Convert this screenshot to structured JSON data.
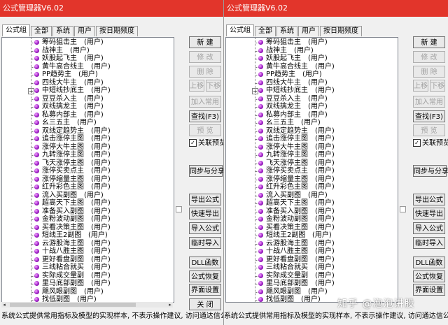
{
  "window_title": "公式管理器V6.02",
  "tabs": [
    "公式组",
    "全部",
    "系统",
    "用户",
    "按日期频度"
  ],
  "formulas": [
    {
      "name": "筹码狙击主",
      "source": "(用户)"
    },
    {
      "name": "战神主",
      "source": "(用户)"
    },
    {
      "name": "妖股起飞主",
      "source": "(用户)"
    },
    {
      "name": "黄牛高合线主",
      "source": "(用户)"
    },
    {
      "name": "PP趋势主",
      "source": "(用户)"
    },
    {
      "name": "四线大牛主",
      "source": "(用户)"
    },
    {
      "name": "中短线抄底主",
      "source": "(用户)"
    },
    {
      "name": "豆豆杀入主",
      "source": "(用户)"
    },
    {
      "name": "双线擒龙主",
      "source": "(用户)"
    },
    {
      "name": "私募内部主",
      "source": "(用户)"
    },
    {
      "name": "幺三五主",
      "source": "(用户)"
    },
    {
      "name": "双线定趋势主",
      "source": "(用户)"
    },
    {
      "name": "追击涨停主图",
      "source": "(用户)"
    },
    {
      "name": "涨停大牛主图",
      "source": "(用户)"
    },
    {
      "name": "九转涨停主图",
      "source": "(用户)"
    },
    {
      "name": "飞天涨停主图",
      "source": "(用户)"
    },
    {
      "name": "涨停买卖点主",
      "source": "(用户)"
    },
    {
      "name": "涨停缩量主图",
      "source": "(用户)"
    },
    {
      "name": "红升彩色主图",
      "source": "(用户)"
    },
    {
      "name": "流入买副图",
      "source": "(用户)"
    },
    {
      "name": "超高天下主图",
      "source": "(用户)"
    },
    {
      "name": "准备买入副图",
      "source": "(用户)"
    },
    {
      "name": "金粉波动副图",
      "source": "(用户)"
    },
    {
      "name": "买看决策主图",
      "source": "(用户)"
    },
    {
      "name": "短线王2副图",
      "source": "(用户)"
    },
    {
      "name": "云游股海主图",
      "source": "(用户)"
    },
    {
      "name": "十战八胜主图",
      "source": "(用户)"
    },
    {
      "name": "更好看盘副图",
      "source": "(用户)"
    },
    {
      "name": "三线粘合就买",
      "source": "(用户)"
    },
    {
      "name": "实际成交量副",
      "source": "(用户)"
    },
    {
      "name": "里马底部副图",
      "source": "(用户)"
    },
    {
      "name": "飓风眼副图",
      "source": "(用户)"
    },
    {
      "name": "找低副图",
      "source": "(用户)"
    }
  ],
  "buttons": {
    "new": "新 建",
    "modify": "修 改",
    "delete": "删 除",
    "move_up": "上移",
    "move_down": "下移",
    "add_common": "加入常用",
    "find": "查找(F3)",
    "preview": "预 览",
    "sync_share": "同步与分享",
    "export": "导出公式",
    "quick_export": "快速导出",
    "import": "导入公式",
    "temp_import": "临时导入",
    "dll": "DLL函数",
    "restore": "公式恢复",
    "ui_settings": "界面设置",
    "close": "关 闭"
  },
  "checkbox_label": "关联预览",
  "status_text": "系统公式提供常用指标及模型的实现样本, 不表示操作建议, 访问通达信公式讨论区",
  "watermark": "知乎 @泡泡讲股"
}
